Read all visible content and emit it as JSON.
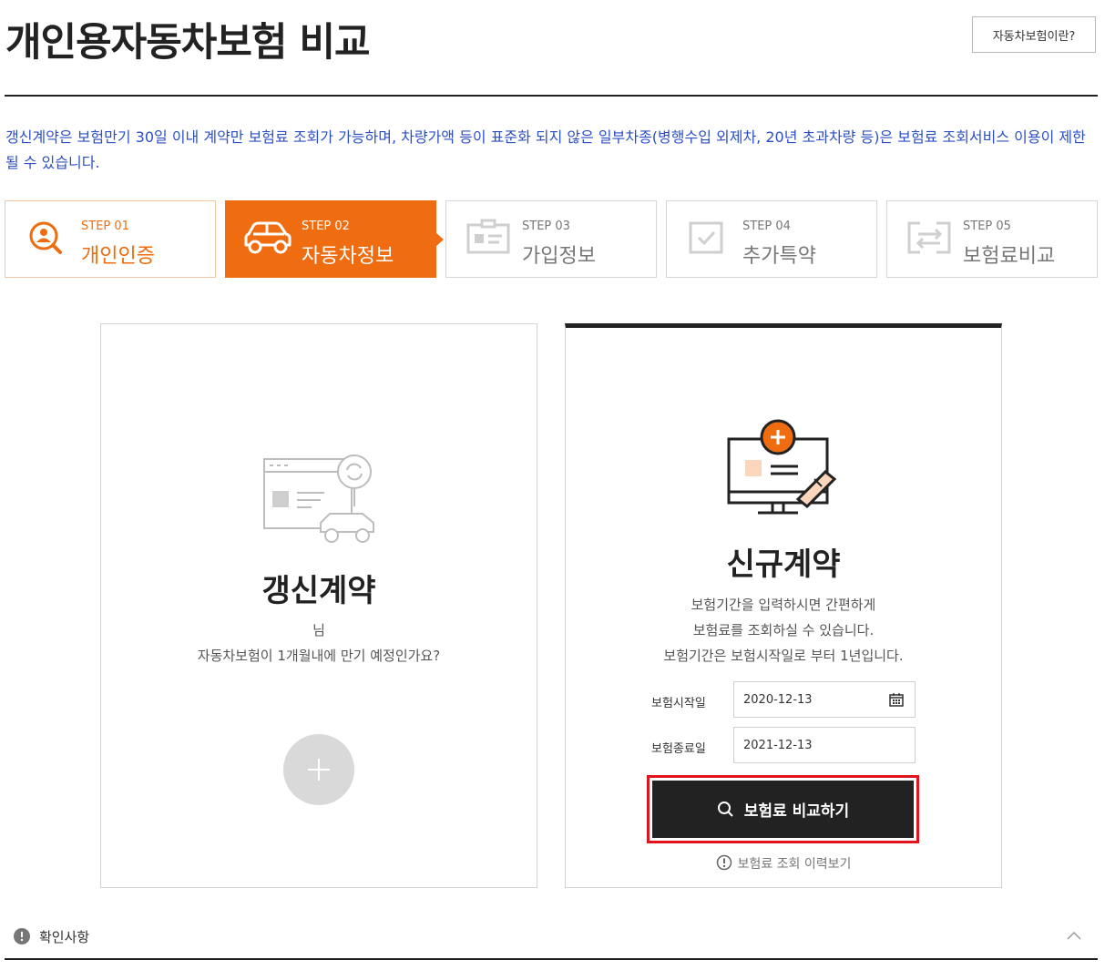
{
  "header": {
    "title": "개인용자동차보험 비교",
    "about_button": "자동차보험이란?"
  },
  "notice": "갱신계약은 보험만기 30일 이내 계약만 보험료 조회가 가능하며, 차량가액 등이 표준화 되지 않은 일부차종(병행수입 외제차, 20년 초과차량 등)은 보험료 조회서비스 이용이 제한 될 수 있습니다.",
  "steps": [
    {
      "num": "STEP 01",
      "name": "개인인증",
      "state": "done",
      "icon": "user-search-icon"
    },
    {
      "num": "STEP 02",
      "name": "자동차정보",
      "state": "active",
      "icon": "car-icon"
    },
    {
      "num": "STEP 03",
      "name": "가입정보",
      "state": "pending",
      "icon": "id-card-icon"
    },
    {
      "num": "STEP 04",
      "name": "추가특약",
      "state": "pending",
      "icon": "checkbox-icon"
    },
    {
      "num": "STEP 05",
      "name": "보험료비교",
      "state": "pending",
      "icon": "exchange-icon"
    }
  ],
  "renew_card": {
    "title": "갱신계약",
    "user_suffix": "님",
    "question": "자동차보험이 1개월내에 만기 예정인가요?"
  },
  "new_card": {
    "title": "신규계약",
    "desc": [
      "보험기간을 입력하시면 간편하게",
      "보험료를 조회하실 수 있습니다.",
      "보험기간은 보험시작일로 부터 1년입니다."
    ],
    "start_label": "보험시작일",
    "start_value": "2020-12-13",
    "end_label": "보험종료일",
    "end_value": "2021-12-13",
    "compare_button": "보험료 비교하기",
    "history_link": "보험료 조회 이력보기"
  },
  "confirm": {
    "label": "확인사항"
  },
  "colors": {
    "accent": "#ef6d10",
    "notice_text": "#2d4fc4",
    "highlight": "#e0141e"
  }
}
